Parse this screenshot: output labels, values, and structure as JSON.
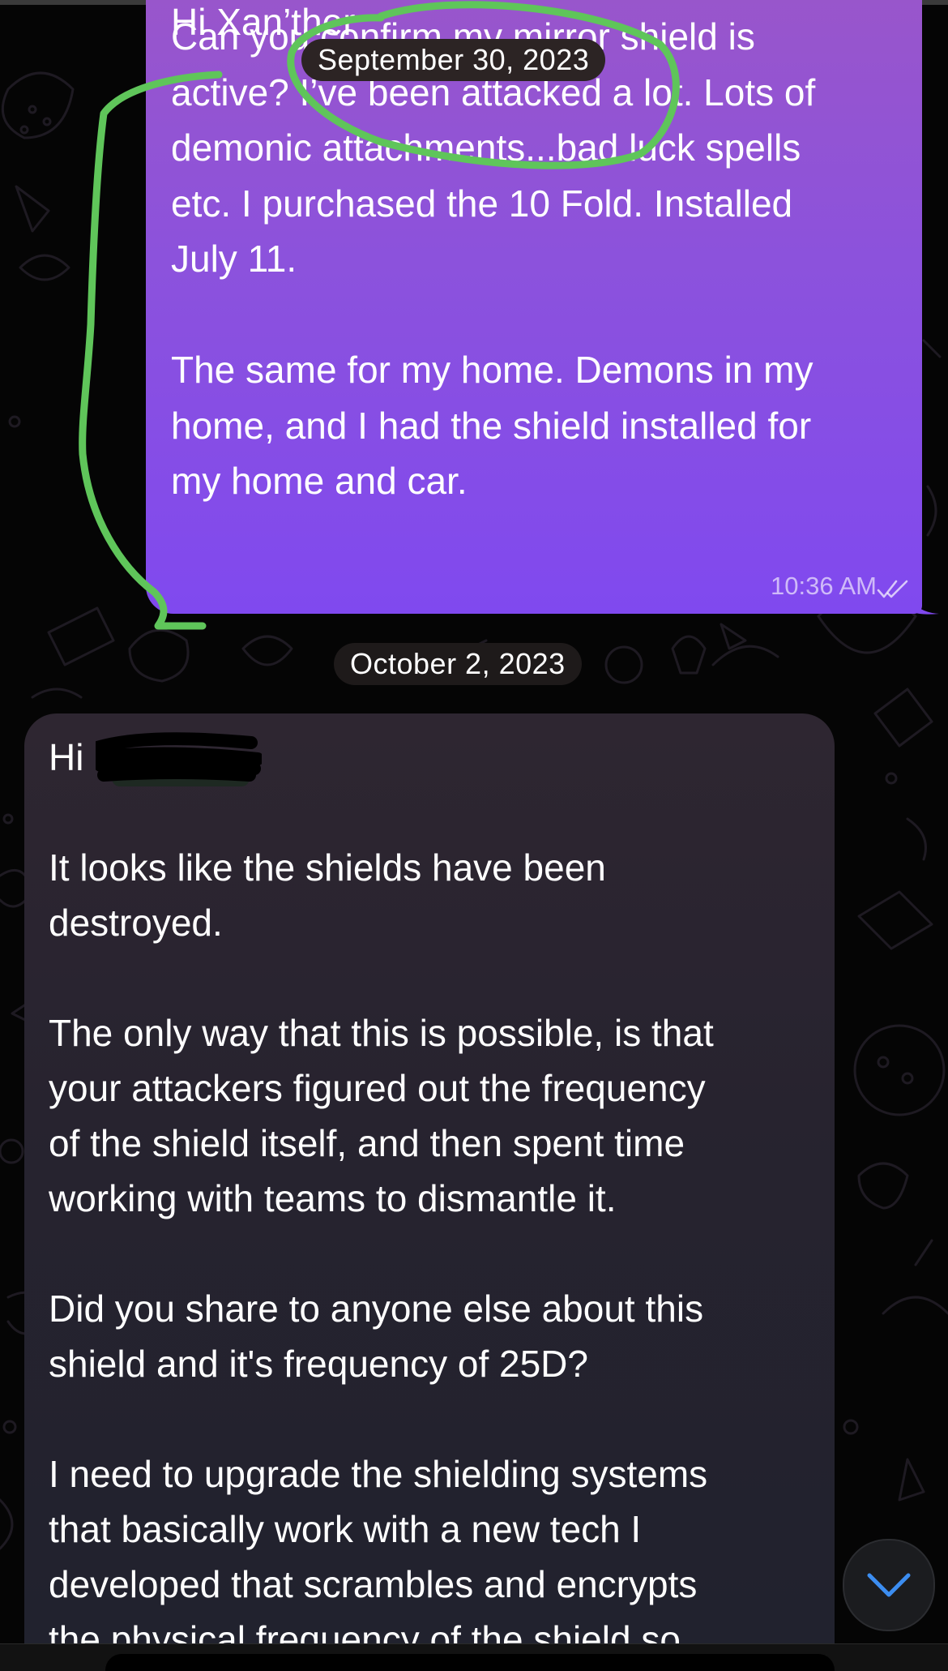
{
  "chat": {
    "outgoing": {
      "text": "Can you confirm my mirror shield is\nactive? I’ve been attacked a lot. Lots of\ndemonic attachments...bad luck spells\netc. I purchased the 10 Fold. Installed\nJuly 11.\n\nThe same for my home. Demons in my\nhome, and I had the shield installed for\nmy home and car.",
      "time": "10:36 AM",
      "read_status_icon": "double-check-icon",
      "partial_top_text": "Hi Xan’ther"
    },
    "date_separators": [
      "September 30, 2023",
      "October 2, 2023"
    ],
    "incoming": {
      "greeting": "Hi ",
      "text": "\n\nIt looks like the shields have been\ndestroyed.\n\nThe only way that this is possible, is that\nyour attackers figured out the frequency\nof the shield itself, and then spent time\nworking with teams to dismantle it.\n\nDid you share to anyone else about this\nshield and it's frequency of 25D?\n\nI need to upgrade the shielding systems\nthat basically work with a new tech I\ndeveloped that scrambles and encrypts\nthe physical frequency of the shield so"
    }
  },
  "controls": {
    "scroll_down_icon": "chevron-down-icon"
  },
  "colors": {
    "outgoing_bubble": "#8c52dc",
    "incoming_bubble": "#27232f",
    "annotation_stroke": "#5fc55a",
    "scroll_accent": "#3c8df0",
    "background": "#050505"
  }
}
